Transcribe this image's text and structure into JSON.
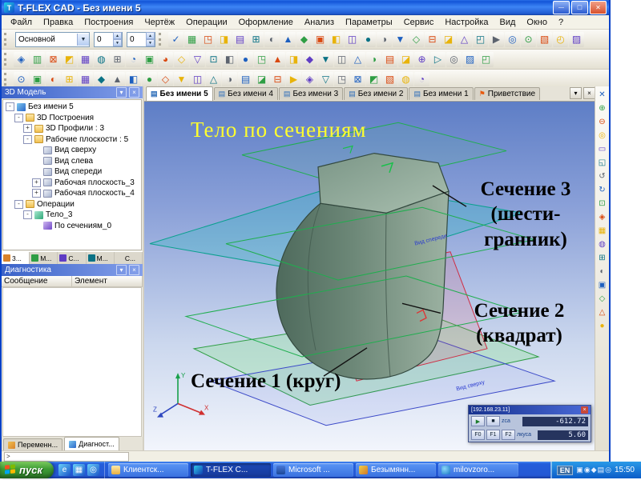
{
  "window": {
    "title": "T-FLEX CAD - Без имени 5"
  },
  "menu": {
    "items": [
      "Файл",
      "Правка",
      "Построения",
      "Чертёж",
      "Операции",
      "Оформление",
      "Анализ",
      "Параметры",
      "Сервис",
      "Настройка",
      "Вид",
      "Окно",
      "?"
    ]
  },
  "toolbars": {
    "combo": "Основной",
    "spin1": "0",
    "spin2": "0",
    "row1": [
      "✓",
      "▦",
      "◳",
      "◨",
      "▤",
      "⊞",
      "◐",
      "▲",
      "◆",
      "▣",
      "◧",
      "◫",
      "●",
      "◑",
      "▼",
      "◇",
      "⊟",
      "◪",
      "△",
      "◰",
      "▶",
      "◎",
      "⊙",
      "▧",
      "◴",
      "▨"
    ],
    "row2": [
      "◈",
      "▥",
      "⊠",
      "◩",
      "▦",
      "◍",
      "⊞",
      "◔",
      "▣",
      "◕",
      "◇",
      "▽",
      "⊡",
      "◧",
      "●",
      "◳",
      "▲",
      "◨",
      "◆",
      "▼",
      "◫",
      "△",
      "◑",
      "▤",
      "◪",
      "⊕",
      "▷",
      "◎",
      "▨",
      "◰"
    ],
    "row3": [
      "⊙",
      "▣",
      "◐",
      "⊞",
      "▦",
      "◆",
      "▲",
      "◧",
      "●",
      "◇",
      "▼",
      "◫",
      "△",
      "◑",
      "▤",
      "◪",
      "⊟",
      "▶",
      "◈",
      "▽",
      "◳",
      "⊠",
      "◩",
      "▧",
      "◍",
      "◔"
    ],
    "right": [
      "✕",
      "⊕",
      "⊖",
      "◎",
      "▭",
      "◱",
      "↺",
      "↻",
      "⊡",
      "◈",
      "▦",
      "◍",
      "⊞",
      "◐",
      "▣",
      "◇",
      "△",
      "●"
    ]
  },
  "model_tree": {
    "title": "3D Модель",
    "nodes": [
      {
        "label": "Без имени 5",
        "indent": 0,
        "icon": "doc",
        "toggle": "-"
      },
      {
        "label": "3D Построения",
        "indent": 1,
        "icon": "folder",
        "toggle": "-"
      },
      {
        "label": "3D Профили : 3",
        "indent": 2,
        "icon": "folder",
        "toggle": "+"
      },
      {
        "label": "Рабочие плоскости : 5",
        "indent": 2,
        "icon": "folder",
        "toggle": "-"
      },
      {
        "label": "Вид сверху",
        "indent": 3,
        "icon": "plane"
      },
      {
        "label": "Вид слева",
        "indent": 3,
        "icon": "plane"
      },
      {
        "label": "Вид спереди",
        "indent": 3,
        "icon": "plane"
      },
      {
        "label": "Рабочая плоскость_3",
        "indent": 3,
        "icon": "plane",
        "toggle": "+"
      },
      {
        "label": "Рабочая плоскость_4",
        "indent": 3,
        "icon": "plane",
        "toggle": "+"
      },
      {
        "label": "Операции",
        "indent": 1,
        "icon": "folder",
        "toggle": "-"
      },
      {
        "label": "Тело_3",
        "indent": 2,
        "icon": "body",
        "toggle": "-"
      },
      {
        "label": "По сечениям_0",
        "indent": 3,
        "icon": "op"
      }
    ]
  },
  "mini_tabs": [
    {
      "label": "3...",
      "active": true
    },
    {
      "label": "М..."
    },
    {
      "label": "С..."
    },
    {
      "label": "М..."
    },
    {
      "label": "С..."
    }
  ],
  "diagnostics": {
    "title": "Диагностика",
    "columns": [
      "Сообщение",
      "Элемент"
    ]
  },
  "panel_tabs": [
    {
      "label": "Переменн..."
    },
    {
      "label": "Диагност...",
      "active": true
    }
  ],
  "doc_tabs": [
    {
      "label": "Без имени 5",
      "icon": "page",
      "active": true
    },
    {
      "label": "Без имени 4",
      "icon": "page"
    },
    {
      "label": "Без имени 3",
      "icon": "page"
    },
    {
      "label": "Без имени 2",
      "icon": "page"
    },
    {
      "label": "Без имени 1",
      "icon": "page"
    },
    {
      "label": "Приветствие",
      "icon": "flag"
    }
  ],
  "viewport": {
    "annotations": {
      "title": "Тело по сечениям",
      "sec3_line1": "Сечение 3",
      "sec3_line2": "(шести-",
      "sec3_line3": "гранник)",
      "sec2_line1": "Сечение 2",
      "sec2_line2": "(квадрат)",
      "sec1": "Сечение 1 (круг)"
    },
    "plane_label_front": "Вид спереди",
    "plane_label_top": "Вид сверху",
    "triad": {
      "x": "X",
      "y": "Y",
      "z": "Z"
    }
  },
  "coord_panel": {
    "title": "[192.168.23.11]",
    "btn_play": "▶",
    "btn_stop": "■",
    "f_buttons": [
      "F0",
      "F1",
      "F2"
    ],
    "label1": "zca",
    "label2": "лкуса",
    "value1": "-612.72",
    "value2": "5.60"
  },
  "status": {
    "prompt": ">"
  },
  "taskbar": {
    "start": "пуск",
    "quick": [
      "e",
      "▦",
      "◎"
    ],
    "items": [
      {
        "label": "Клиентск...",
        "icon": "folder2"
      },
      {
        "label": "T-FLEX C...",
        "icon": "tf",
        "active": true
      },
      {
        "label": "Microsoft ...",
        "icon": "word"
      },
      {
        "label": "Безымянн...",
        "icon": "paint"
      },
      {
        "label": "milovzoro...",
        "icon": "ie"
      }
    ],
    "lang": "EN",
    "tray": [
      "▣",
      "◉",
      "◆",
      "▤",
      "◎"
    ],
    "clock": "15:50"
  }
}
